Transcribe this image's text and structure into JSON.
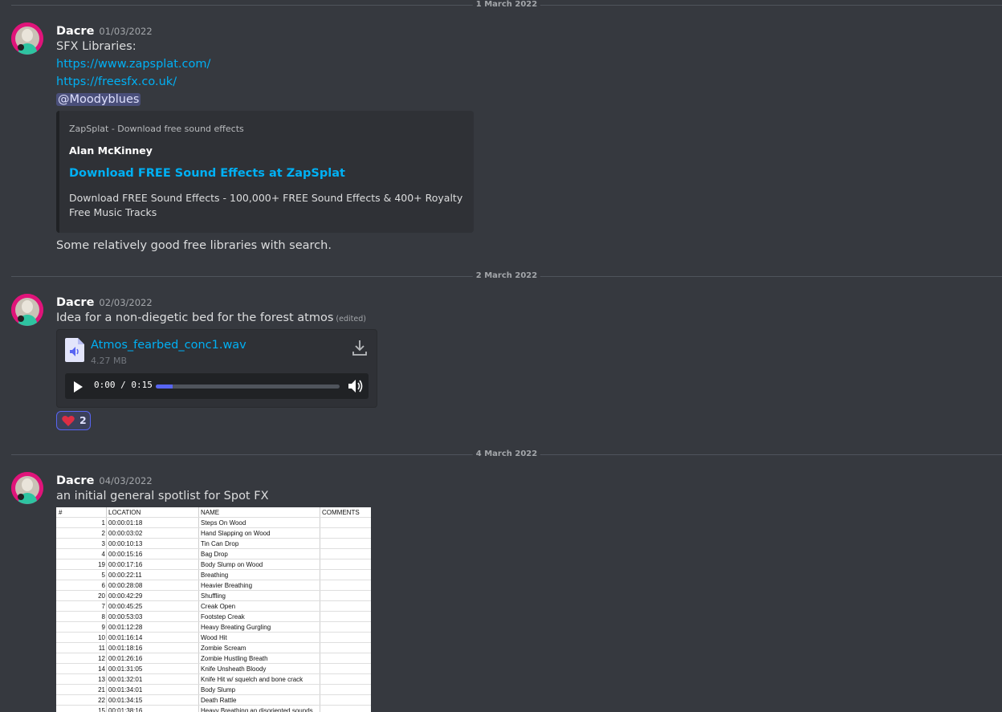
{
  "dividers": [
    "1 March 2022",
    "2 March 2022",
    "4 March 2022"
  ],
  "messages": [
    {
      "username": "Dacre",
      "timestamp": "01/03/2022",
      "lines": [
        "SFX Libraries:",
        "https://www.zapsplat.com/",
        "https://freesfx.co.uk/",
        "@Moodyblues"
      ],
      "embed": {
        "provider": "ZapSplat - Download free sound effects",
        "author": "Alan McKinney",
        "title": "Download FREE Sound Effects at ZapSplat",
        "description": "Download FREE Sound Effects - 100,000+ FREE Sound Effects & 400+ Royalty Free Music Tracks"
      },
      "footer": "Some relatively good free libraries with search."
    },
    {
      "username": "Dacre",
      "timestamp": "02/03/2022",
      "text": "Idea for a non-diegetic bed for the forest atmos",
      "edited": "(edited)",
      "attachment": {
        "filename": "Atmos_fearbed_conc1.wav",
        "size": "4.27 MB",
        "time": "0:00 / 0:15",
        "progress": 0.09
      },
      "reaction": {
        "emoji": "heart-icon",
        "count": "2",
        "color": "#dd2e44"
      }
    },
    {
      "username": "Dacre",
      "timestamp": "04/03/2022",
      "text": "an initial general spotlist for Spot FX",
      "spotlist": {
        "headers": [
          "#",
          "LOCATION",
          "NAME",
          "COMMENTS"
        ],
        "rows": [
          [
            "1",
            "00:00:01:18",
            "Steps On Wood"
          ],
          [
            "2",
            "00:00:03:02",
            "Hand Slapping on Wood"
          ],
          [
            "3",
            "00:00:10:13",
            "Tin Can Drop"
          ],
          [
            "4",
            "00:00:15:16",
            "Bag Drop"
          ],
          [
            "19",
            "00:00:17:16",
            "Body Slump on Wood"
          ],
          [
            "5",
            "00:00:22:11",
            "Breathing"
          ],
          [
            "6",
            "00:00:28:08",
            "Heavier Breathing"
          ],
          [
            "20",
            "00:00:42:29",
            "Shuffling"
          ],
          [
            "7",
            "00:00:45:25",
            "Creak Open"
          ],
          [
            "8",
            "00:00:53:03",
            "Footstep Creak"
          ],
          [
            "9",
            "00:01:12:28",
            "Heavy Breating Gurgling"
          ],
          [
            "10",
            "00:01:16:14",
            "Wood Hit"
          ],
          [
            "11",
            "00:01:18:16",
            "Zombie Scream"
          ],
          [
            "12",
            "00:01:26:16",
            "Zombie Hustling Breath"
          ],
          [
            "14",
            "00:01:31:05",
            "Knife Unsheath Bloody"
          ],
          [
            "13",
            "00:01:32:01",
            "Knife Hit w/ squelch and bone crack"
          ],
          [
            "21",
            "00:01:34:01",
            "Body Slump"
          ],
          [
            "22",
            "00:01:34:15",
            "Death Rattle"
          ],
          [
            "15",
            "00:01:38:16",
            "Heavy Breathing an disoriented sounds"
          ]
        ]
      }
    }
  ],
  "colors": {
    "background": "#36393f",
    "link": "#00b0f4",
    "accent": "#5865f2",
    "avatar": "#e0147a"
  }
}
